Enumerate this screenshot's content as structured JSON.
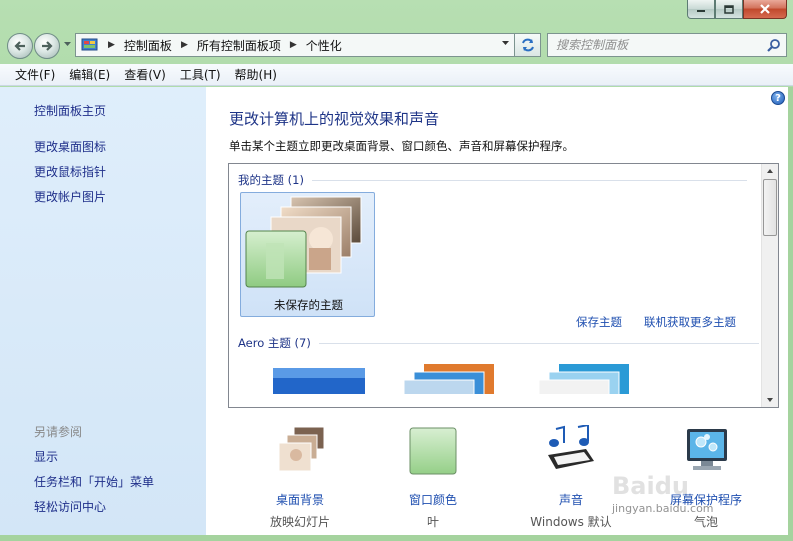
{
  "window": {
    "caption_buttons": [
      "minimize",
      "maximize",
      "close"
    ]
  },
  "address_bar": {
    "crumbs": [
      "控制面板",
      "所有控制面板项",
      "个性化"
    ]
  },
  "search": {
    "placeholder": "搜索控制面板"
  },
  "menu": {
    "items": [
      "文件(F)",
      "编辑(E)",
      "查看(V)",
      "工具(T)",
      "帮助(H)"
    ]
  },
  "sidebar": {
    "home": "控制面板主页",
    "links": [
      "更改桌面图标",
      "更改鼠标指针",
      "更改帐户图片"
    ],
    "see_also_title": "另请参阅",
    "see_also": [
      "显示",
      "任务栏和「开始」菜单",
      "轻松访问中心"
    ]
  },
  "main": {
    "help": "?",
    "title": "更改计算机上的视觉效果和声音",
    "description": "单击某个主题立即更改桌面背景、窗口颜色、声音和屏幕保护程序。",
    "my_themes_head": "我的主题 (1)",
    "unsaved_theme_label": "未保存的主题",
    "save_theme": "保存主题",
    "get_more_themes": "联机获取更多主题",
    "aero_themes_head": "Aero 主题 (7)"
  },
  "bottom": {
    "items": [
      {
        "label": "桌面背景",
        "sub": "放映幻灯片"
      },
      {
        "label": "窗口颜色",
        "sub": "叶"
      },
      {
        "label": "声音",
        "sub": "Windows 默认"
      },
      {
        "label": "屏幕保护程序",
        "sub": "气泡"
      }
    ]
  },
  "watermark": {
    "brand": "Baidu",
    "text": "jingyan.baidu.com"
  },
  "colors": {
    "frame_green": "#a6d6a0",
    "sidebar_bg": "#d9eafa",
    "link_blue": "#1f4fb0",
    "title_blue": "#1e3487"
  }
}
